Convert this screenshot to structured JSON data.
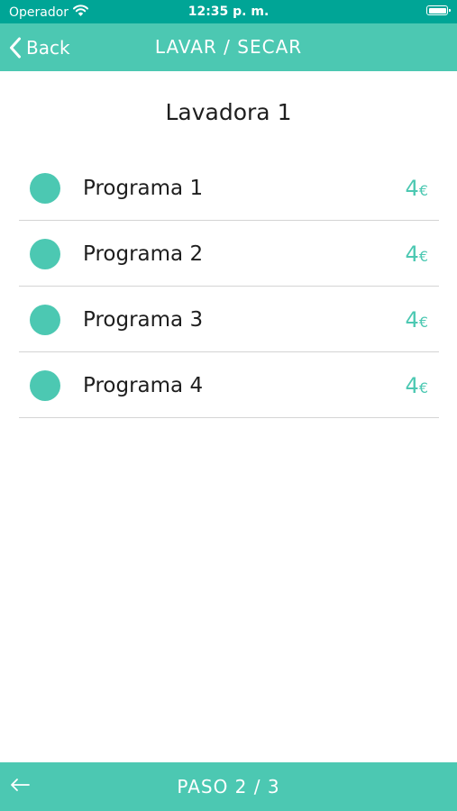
{
  "status_bar": {
    "carrier": "Operador",
    "time": "12:35 p. m.",
    "wifi_icon": "wifi-icon",
    "battery_icon": "battery-icon"
  },
  "nav_bar": {
    "back_label": "Back",
    "back_icon": "chevron-left-icon",
    "title": "LAVAR / SECAR"
  },
  "machine": {
    "name": "Lavadora 1"
  },
  "programs": [
    {
      "name": "Programa 1",
      "price": "4",
      "currency": "€"
    },
    {
      "name": "Programa 2",
      "price": "4",
      "currency": "€"
    },
    {
      "name": "Programa 3",
      "price": "4",
      "currency": "€"
    },
    {
      "name": "Programa 4",
      "price": "4",
      "currency": "€"
    }
  ],
  "footer": {
    "back_icon": "arrow-left-icon",
    "step": "PASO 2 / 3"
  },
  "colors": {
    "status_bar": "#00a596",
    "accent": "#4cc8b2",
    "divider": "#d4d4d4",
    "text": "#1e1e1e"
  }
}
